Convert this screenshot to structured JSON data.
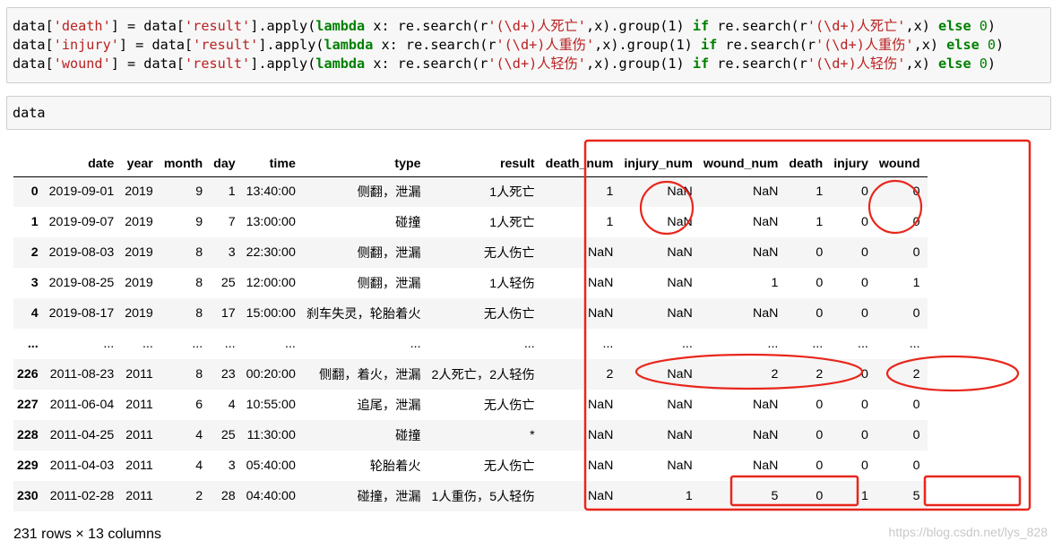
{
  "code_cell": {
    "lines": [
      [
        "data[",
        "'death'",
        "] = data[",
        "'result'",
        "].apply(",
        "lambda",
        " x: re.search(r",
        "'(\\d+)人死亡'",
        ",x).group(1) ",
        "if",
        " re.search(r",
        "'(\\d+)人死亡'",
        ",x) ",
        "else",
        " ",
        "0",
        ")"
      ],
      [
        "data[",
        "'injury'",
        "] = data[",
        "'result'",
        "].apply(",
        "lambda",
        " x: re.search(r",
        "'(\\d+)人重伤'",
        ",x).group(1) ",
        "if",
        " re.search(r",
        "'(\\d+)人重伤'",
        ",x) ",
        "else",
        " ",
        "0",
        ")"
      ],
      [
        "data[",
        "'wound'",
        "] = data[",
        "'result'",
        "].apply(",
        "lambda",
        " x: re.search(r",
        "'(\\d+)人轻伤'",
        ",x).group(1) ",
        "if",
        " re.search(r",
        "'(\\d+)人轻伤'",
        ",x) ",
        "else",
        " ",
        "0",
        ")"
      ]
    ]
  },
  "input_cell": {
    "text": "data"
  },
  "table": {
    "columns": [
      "",
      "date",
      "year",
      "month",
      "day",
      "time",
      "type",
      "result",
      "death_num",
      "injury_num",
      "wound_num",
      "death",
      "injury",
      "wound"
    ],
    "rows": [
      [
        "0",
        "2019-09-01",
        "2019",
        "9",
        "1",
        "13:40:00",
        "侧翻，泄漏",
        "1人死亡",
        "1",
        "NaN",
        "NaN",
        "1",
        "0",
        "0"
      ],
      [
        "1",
        "2019-09-07",
        "2019",
        "9",
        "7",
        "13:00:00",
        "碰撞",
        "1人死亡",
        "1",
        "NaN",
        "NaN",
        "1",
        "0",
        "0"
      ],
      [
        "2",
        "2019-08-03",
        "2019",
        "8",
        "3",
        "22:30:00",
        "侧翻，泄漏",
        "无人伤亡",
        "NaN",
        "NaN",
        "NaN",
        "0",
        "0",
        "0"
      ],
      [
        "3",
        "2019-08-25",
        "2019",
        "8",
        "25",
        "12:00:00",
        "侧翻，泄漏",
        "1人轻伤",
        "NaN",
        "NaN",
        "1",
        "0",
        "0",
        "1"
      ],
      [
        "4",
        "2019-08-17",
        "2019",
        "8",
        "17",
        "15:00:00",
        "刹车失灵，轮胎着火",
        "无人伤亡",
        "NaN",
        "NaN",
        "NaN",
        "0",
        "0",
        "0"
      ],
      [
        "...",
        "...",
        "...",
        "...",
        "...",
        "...",
        "...",
        "...",
        "...",
        "...",
        "...",
        "...",
        "...",
        "..."
      ],
      [
        "226",
        "2011-08-23",
        "2011",
        "8",
        "23",
        "00:20:00",
        "侧翻，着火，泄漏",
        "2人死亡，2人轻伤",
        "2",
        "NaN",
        "2",
        "2",
        "0",
        "2"
      ],
      [
        "227",
        "2011-06-04",
        "2011",
        "6",
        "4",
        "10:55:00",
        "追尾，泄漏",
        "无人伤亡",
        "NaN",
        "NaN",
        "NaN",
        "0",
        "0",
        "0"
      ],
      [
        "228",
        "2011-04-25",
        "2011",
        "4",
        "25",
        "11:30:00",
        "碰撞",
        "*",
        "NaN",
        "NaN",
        "NaN",
        "0",
        "0",
        "0"
      ],
      [
        "229",
        "2011-04-03",
        "2011",
        "4",
        "3",
        "05:40:00",
        "轮胎着火",
        "无人伤亡",
        "NaN",
        "NaN",
        "NaN",
        "0",
        "0",
        "0"
      ],
      [
        "230",
        "2011-02-28",
        "2011",
        "2",
        "28",
        "04:40:00",
        "碰撞，泄漏",
        "1人重伤，5人轻伤",
        "NaN",
        "1",
        "5",
        "0",
        "1",
        "5"
      ]
    ]
  },
  "footer": {
    "shape_text": "231 rows × 13 columns"
  },
  "watermark": {
    "text": "https://blog.csdn.net/lys_828"
  },
  "annotation_color": "#e8261c"
}
